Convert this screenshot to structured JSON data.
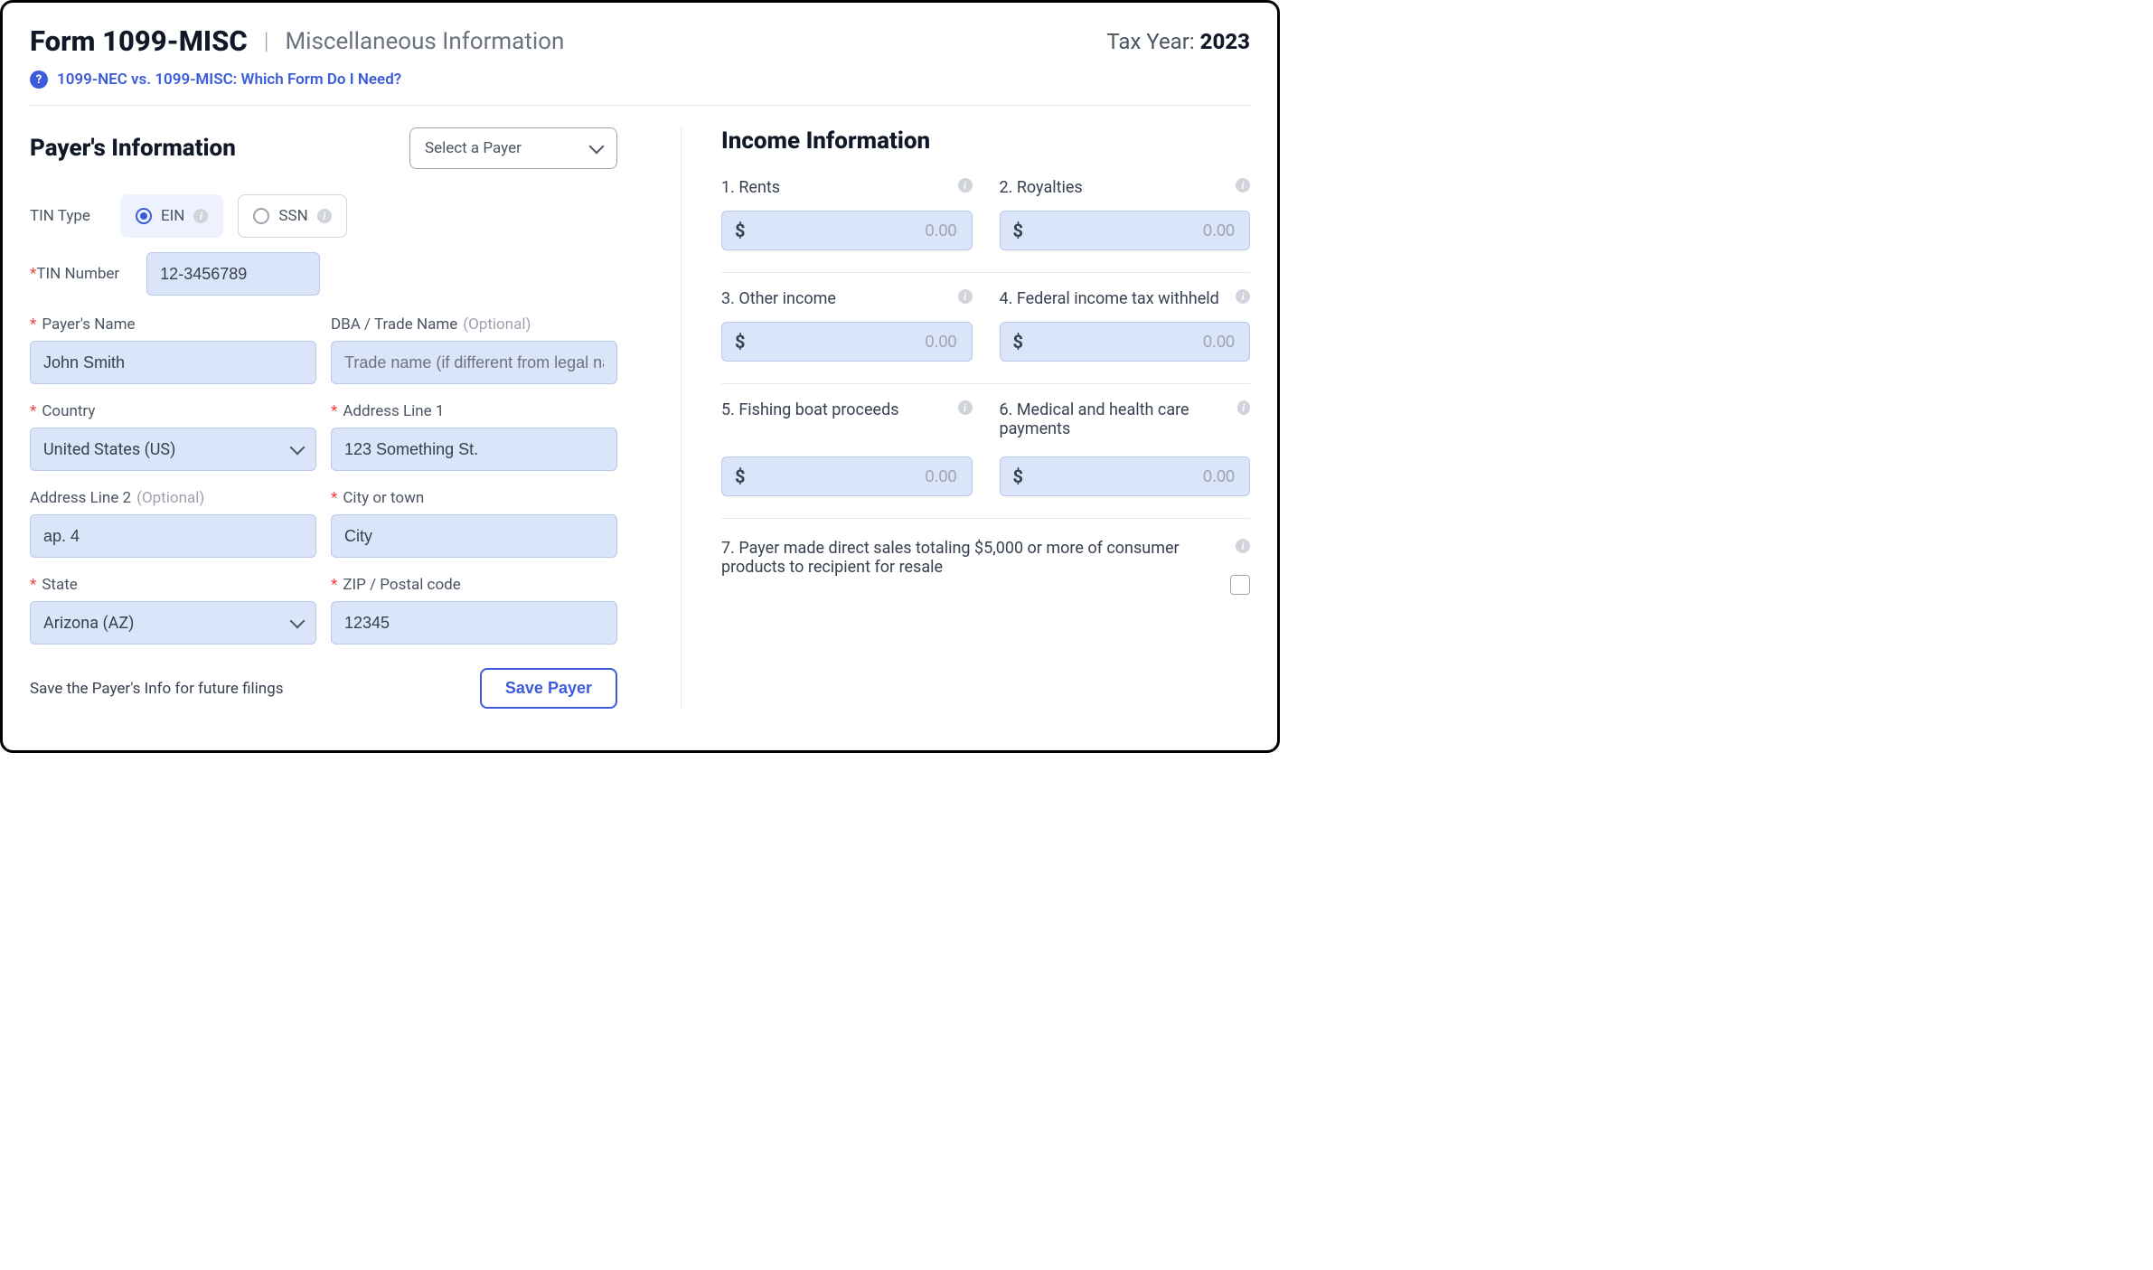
{
  "header": {
    "form_title": "Form 1099-MISC",
    "subtitle": "Miscellaneous Information",
    "tax_year_label": "Tax Year: ",
    "tax_year_value": "2023"
  },
  "help": {
    "link_text": "1099-NEC vs. 1099-MISC: Which Form Do I Need?"
  },
  "payer": {
    "section_title": "Payer's Information",
    "select_placeholder": "Select a Payer",
    "tin_type_label": "TIN Type",
    "tin_type_options": {
      "ein": "EIN",
      "ssn": "SSN"
    },
    "tin_number_label": "TIN Number",
    "tin_number_value": "12-3456789",
    "name_label": "Payer's Name",
    "name_value": "John Smith",
    "dba_label": "DBA / Trade Name",
    "dba_optional": "(Optional)",
    "dba_placeholder": "Trade name (if different from legal name)",
    "country_label": "Country",
    "country_value": "United States (US)",
    "addr1_label": "Address Line 1",
    "addr1_value": "123 Something St.",
    "addr2_label": "Address Line 2",
    "addr2_optional": "(Optional)",
    "addr2_value": "ap. 4",
    "city_label": "City or town",
    "city_value": "City",
    "state_label": "State",
    "state_value": "Arizona (AZ)",
    "zip_label": "ZIP / Postal code",
    "zip_value": "12345",
    "save_note": "Save the Payer's Info for future filings",
    "save_button": "Save Payer"
  },
  "income": {
    "section_title": "Income Information",
    "currency_sign": "$",
    "placeholder": "0.00",
    "fields": {
      "rents": "1. Rents",
      "royalties": "2. Royalties",
      "other": "3. Other income",
      "fed_withheld": "4. Federal income tax withheld",
      "fishing": "5. Fishing boat proceeds",
      "medical": "6. Medical and health care payments",
      "direct_sales": "7. Payer made direct sales totaling $5,000 or more of consumer products to recipient for resale"
    }
  }
}
